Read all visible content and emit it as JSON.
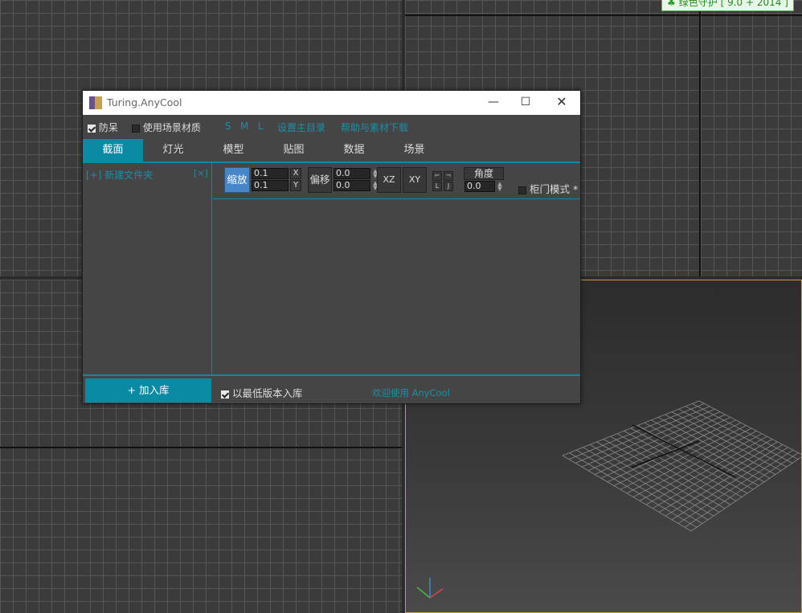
{
  "badge": {
    "icon": "clover-icon",
    "text": "绿色守护 [ 9.0 + 2014 ]"
  },
  "dialog": {
    "title": "Turing.AnyCool",
    "window_controls": {
      "minimize": "—",
      "maximize": "☐",
      "close": "✕"
    },
    "topbar": {
      "anti_freeze": {
        "label": "防呆",
        "checked": true
      },
      "use_scene_material": {
        "label": "使用场景材质",
        "checked": false
      },
      "size_s": "S",
      "size_m": "M",
      "size_l": "L",
      "set_main_dir": "设置主目录",
      "help_download": "帮助与素材下载"
    },
    "tabs": [
      {
        "label": "截面",
        "active": true
      },
      {
        "label": "灯光",
        "active": false
      },
      {
        "label": "模型",
        "active": false
      },
      {
        "label": "贴图",
        "active": false
      },
      {
        "label": "数据",
        "active": false
      },
      {
        "label": "场景",
        "active": false
      }
    ],
    "left_pane": {
      "new_folder": "[+] 新建文件夹",
      "close": "[×]"
    },
    "toolbar": {
      "scale_label": "缩放",
      "scale_x": "0.1",
      "scale_y": "0.1",
      "x_label": "X",
      "y_label": "Y",
      "offset_label": "偏移",
      "offset_x": "0.0",
      "offset_y": "0.0",
      "xz_label": "XZ",
      "xy_label": "XY",
      "corner_tl": "⌐",
      "corner_tr": "¬",
      "corner_bl": "L",
      "corner_br": "J",
      "angle_label": "角度",
      "angle_value": "0.0",
      "cabinet_mode": {
        "label": "柜门模式 *",
        "checked": false
      }
    },
    "bottom": {
      "add_to_library": "+ 加入库",
      "lowest_version": {
        "label": "以最低版本入库",
        "checked": true
      },
      "welcome": "欢迎使用 AnyCool"
    }
  },
  "colors": {
    "accent": "#0a8aa3",
    "active_button": "#4686c9",
    "viewport_highlight": "#c89c3c"
  }
}
